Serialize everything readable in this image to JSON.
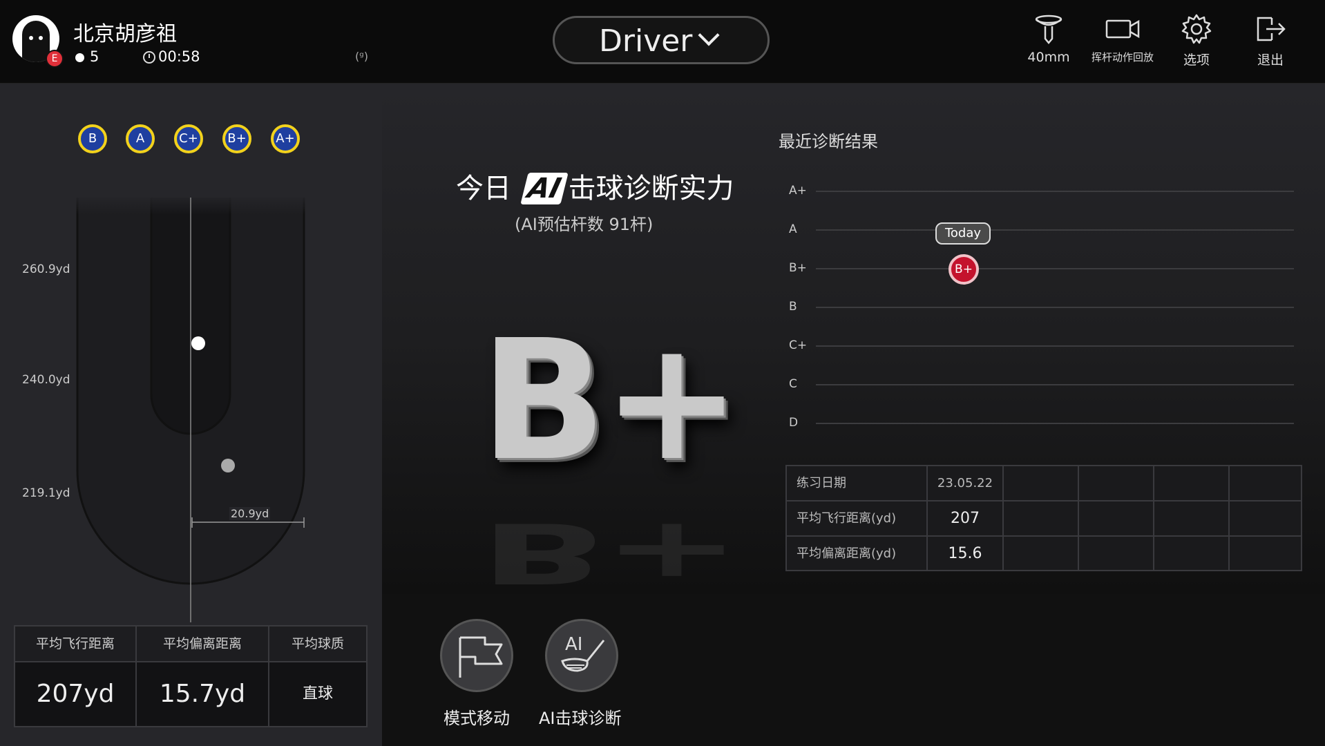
{
  "header": {
    "user_name": "北京胡彦祖",
    "badge": "E",
    "shots": "5",
    "time": "00:58",
    "signal": "(ᵍ)",
    "club": "Driver",
    "buttons": [
      {
        "label": "40mm",
        "icon": "tee-icon"
      },
      {
        "label": "挥杆动作回放",
        "icon": "video-icon"
      },
      {
        "label": "选项",
        "icon": "gear-icon"
      },
      {
        "label": "退出",
        "icon": "exit-icon"
      }
    ]
  },
  "left": {
    "grades": [
      "B",
      "A",
      "C+",
      "B+",
      "A+"
    ],
    "yards": [
      "260.9yd",
      "240.0yd",
      "219.1yd"
    ],
    "offset": "20.9yd",
    "stats": {
      "headers": [
        "平均飞行距离",
        "平均偏离距离",
        "平均球质"
      ],
      "values": [
        "207yd",
        "15.7yd",
        "直球"
      ]
    }
  },
  "diagnosis": {
    "title_pre": "今日",
    "title_ai": "AI",
    "title_post": "击球诊断实力",
    "subtitle": "(AI预估杆数 91杆)",
    "grade": "B+"
  },
  "recent": {
    "title": "最近诊断结果",
    "levels": [
      "A+",
      "A",
      "B+",
      "B",
      "C+",
      "C",
      "D"
    ],
    "today_label": "Today",
    "point_grade": "B+",
    "table": {
      "rows": [
        {
          "label": "练习日期",
          "value": "23.05.22"
        },
        {
          "label": "平均飞行距离(yd)",
          "value": "207"
        },
        {
          "label": "平均偏离距离(yd)",
          "value": "15.6"
        }
      ]
    }
  },
  "bottom": {
    "mode_label": "模式移动",
    "ai_label": "AI击球诊断",
    "ai_icon_text": "AI"
  },
  "colors": {
    "grade_blue": "#1f3fa0",
    "grade_ring": "#f2d21c",
    "point_red": "#c4122d"
  }
}
